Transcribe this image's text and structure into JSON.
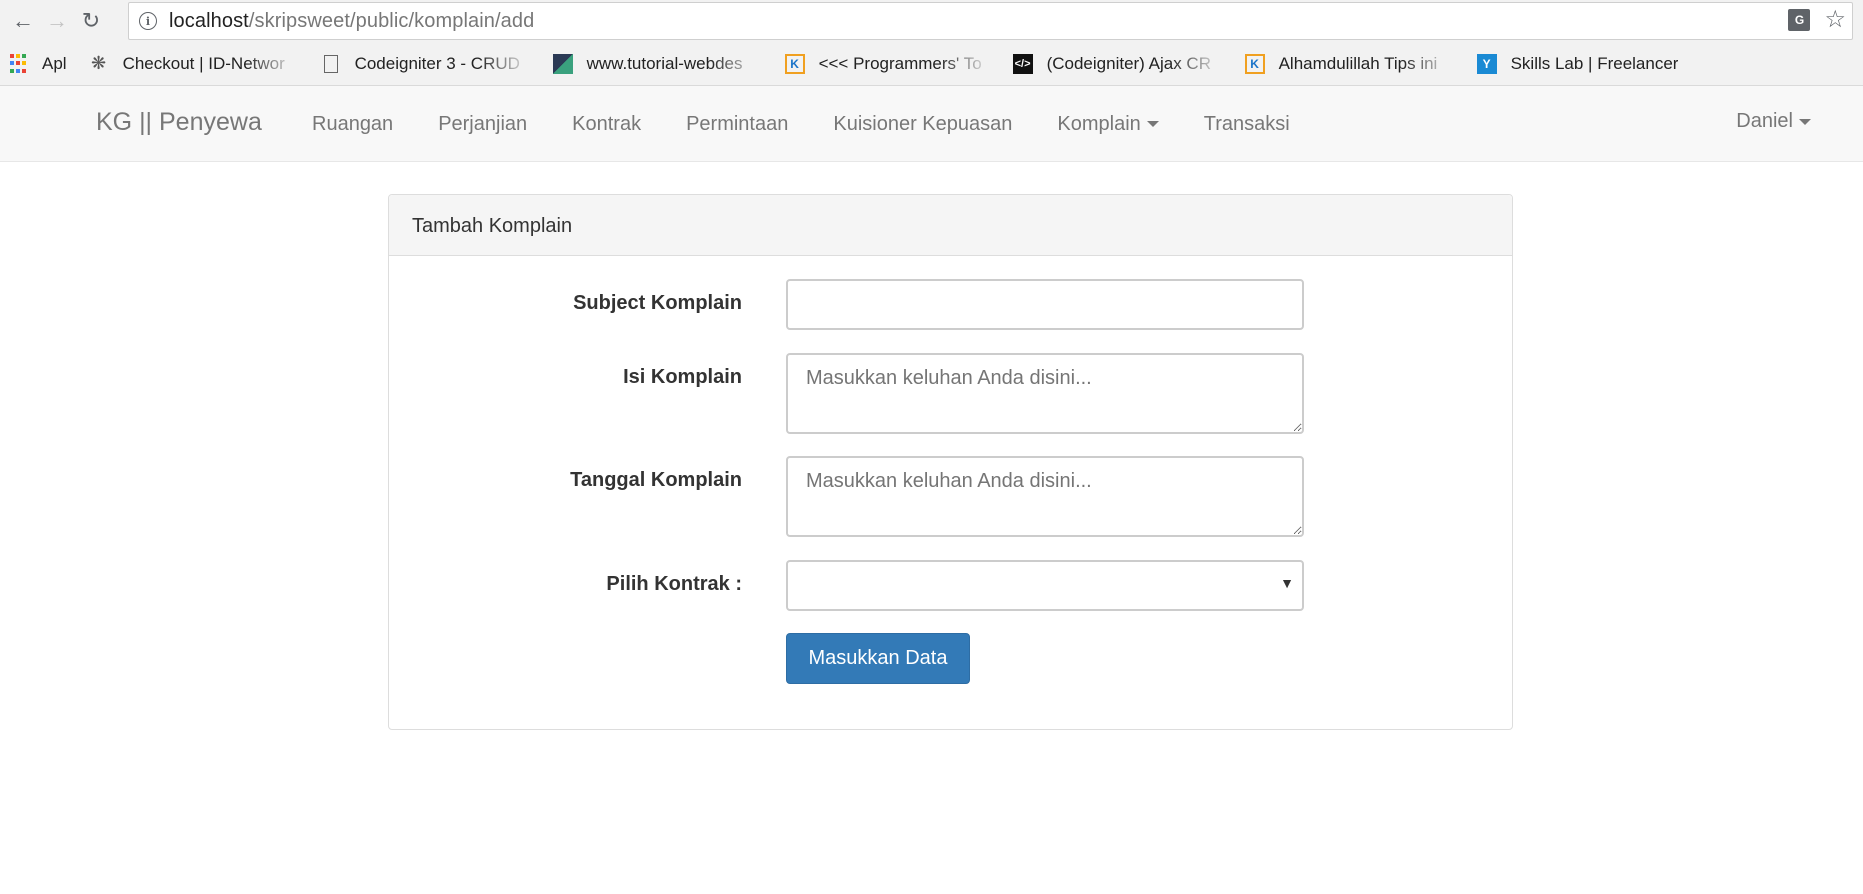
{
  "browser": {
    "url_host": "localhost",
    "url_path": "/skripsweet/public/komplain/add",
    "bookmarks": [
      {
        "label": "Apl",
        "icon": "apps-grid-icon"
      },
      {
        "label": "Checkout | ID-Networ",
        "icon": "gear-logo-icon"
      },
      {
        "label": "Codeigniter 3 - CRUD",
        "icon": "page-icon"
      },
      {
        "label": "www.tutorial-webdes",
        "icon": "site-favicon-icon"
      },
      {
        "label": "<<< Programmers' To",
        "icon": "k-favicon-icon"
      },
      {
        "label": "(Codeigniter) Ajax CR",
        "icon": "code-favicon-icon"
      },
      {
        "label": "Alhamdulillah Tips ini",
        "icon": "k-favicon-icon"
      },
      {
        "label": "Skills Lab | Freelancer",
        "icon": "y-favicon-icon"
      }
    ]
  },
  "navbar": {
    "brand": "KG || Penyewa",
    "links": [
      "Ruangan",
      "Perjanjian",
      "Kontrak",
      "Permintaan",
      "Kuisioner Kepuasan",
      "Komplain",
      "Transaksi"
    ],
    "user": "Daniel"
  },
  "panel": {
    "title": "Tambah Komplain",
    "fields": {
      "subject_label": "Subject Komplain",
      "subject_value": "",
      "isi_label": "Isi Komplain",
      "isi_placeholder": "Masukkan keluhan Anda disini...",
      "tanggal_label": "Tanggal Komplain",
      "tanggal_placeholder": "Masukkan keluhan Anda disini...",
      "kontrak_label": "Pilih Kontrak :",
      "kontrak_value": ""
    },
    "submit_label": "Masukkan Data"
  },
  "colors": {
    "primary": "#337ab7",
    "navbar_bg": "#f8f8f8",
    "panel_heading_bg": "#f5f5f5"
  }
}
